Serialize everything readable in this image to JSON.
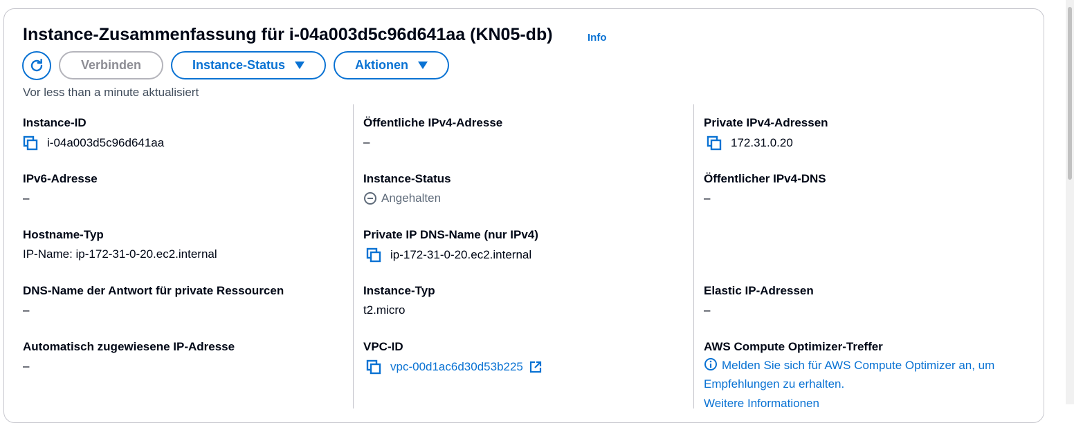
{
  "header": {
    "title": "Instance-Zusammenfassung für i-04a003d5c96d641aa (KN05-db)",
    "info_label": "Info"
  },
  "toolbar": {
    "connect_label": "Verbinden",
    "instance_status_label": "Instance-Status",
    "actions_label": "Aktionen",
    "refresh_icon": "refresh-icon"
  },
  "updated_text": "Vor less than a minute aktualisiert",
  "col1": {
    "instance_id": {
      "label": "Instance-ID",
      "value": "i-04a003d5c96d641aa"
    },
    "ipv6": {
      "label": "IPv6-Adresse",
      "value": "–"
    },
    "hostname_type": {
      "label": "Hostname-Typ",
      "value": "IP-Name: ip-172-31-0-20.ec2.internal"
    },
    "dns_name_answer": {
      "label": "DNS-Name der Antwort für private Ressourcen",
      "value": "–"
    },
    "auto_ip": {
      "label": "Automatisch zugewiesene IP-Adresse",
      "value": "–"
    }
  },
  "col2": {
    "public_ipv4": {
      "label": "Öffentliche IPv4-Adresse",
      "value": "–"
    },
    "instance_status": {
      "label": "Instance-Status",
      "value": "Angehalten"
    },
    "private_dns": {
      "label": "Private IP DNS-Name (nur IPv4)",
      "value": "ip-172-31-0-20.ec2.internal"
    },
    "instance_type": {
      "label": "Instance-Typ",
      "value": "t2.micro"
    },
    "vpc_id": {
      "label": "VPC-ID",
      "value": "vpc-00d1ac6d30d53b225"
    }
  },
  "col3": {
    "private_ipv4": {
      "label": "Private IPv4-Adressen",
      "value": "172.31.0.20"
    },
    "public_dns": {
      "label": "Öffentlicher IPv4-DNS",
      "value": "–"
    },
    "elastic_ip": {
      "label": "Elastic IP-Adressen",
      "value": "–"
    },
    "optimizer": {
      "label": "AWS Compute Optimizer-Treffer",
      "value": "Melden Sie sich für AWS Compute Optimizer an, um Empfehlungen zu erhalten.",
      "more": "Weitere Informationen"
    }
  },
  "colors": {
    "accent": "#0972d3",
    "text": "#000716",
    "muted": "#414d5c",
    "border": "#c6c6cd"
  }
}
